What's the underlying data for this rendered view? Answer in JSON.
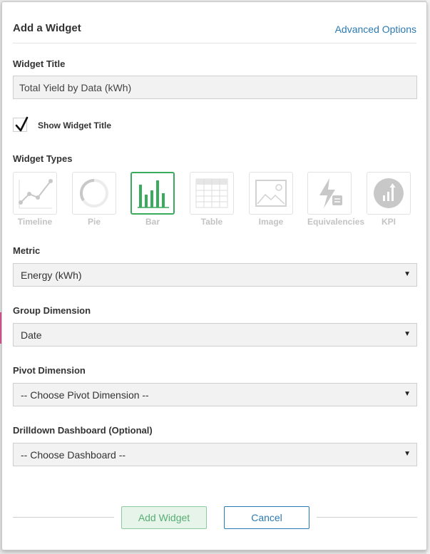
{
  "dialog": {
    "title": "Add a Widget",
    "advanced_options": "Advanced Options"
  },
  "widget_title": {
    "label": "Widget Title",
    "value": "Total Yield by Data (kWh)"
  },
  "show_title": {
    "label": "Show Widget Title",
    "checked": true
  },
  "widget_types": {
    "label": "Widget Types",
    "selected": "Bar",
    "items": [
      {
        "label": "Timeline",
        "icon": "line-chart-icon"
      },
      {
        "label": "Pie",
        "icon": "pie-chart-icon"
      },
      {
        "label": "Bar",
        "icon": "bar-chart-icon"
      },
      {
        "label": "Table",
        "icon": "table-icon"
      },
      {
        "label": "Image",
        "icon": "image-icon"
      },
      {
        "label": "Equivalencies",
        "icon": "lightning-icon"
      },
      {
        "label": "KPI",
        "icon": "kpi-icon"
      }
    ]
  },
  "metric": {
    "label": "Metric",
    "value": "Energy (kWh)"
  },
  "group_dimension": {
    "label": "Group Dimension",
    "value": "Date"
  },
  "pivot_dimension": {
    "label": "Pivot Dimension",
    "value": "-- Choose Pivot Dimension --"
  },
  "drilldown": {
    "label": "Drilldown Dashboard (Optional)",
    "value": "-- Choose Dashboard --"
  },
  "footer": {
    "add_label": "Add Widget",
    "cancel_label": "Cancel"
  },
  "colors": {
    "accent_green": "#3aaa5c",
    "link_blue": "#2b7ab3"
  }
}
